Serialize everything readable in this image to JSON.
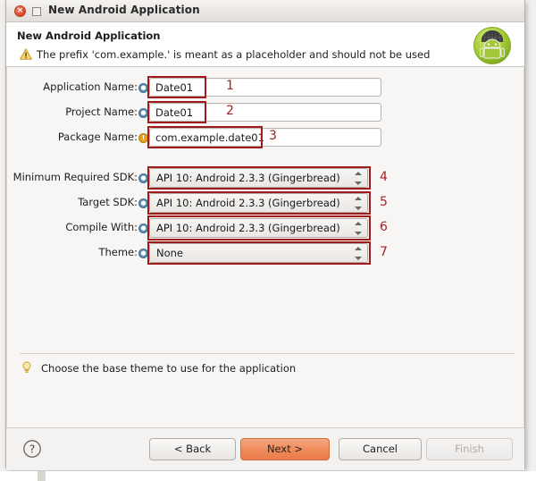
{
  "window": {
    "title": "New Android Application",
    "close_glyph": "×",
    "close_icon_name": "close-icon",
    "maximize_icon_name": "maximize-icon"
  },
  "header": {
    "title": "New Android Application",
    "message": "The prefix 'com.example.' is meant as a placeholder and should not be used",
    "warning_icon": "warning-triangle-icon",
    "logo_icon": "android-robot-icon"
  },
  "form": {
    "text_fields": [
      {
        "label": "Application Name:",
        "value": "Date01",
        "marker": "info",
        "marker_glyph": "●",
        "annotation": "1"
      },
      {
        "label": "Project Name:",
        "value": "Date01",
        "marker": "info",
        "marker_glyph": "●",
        "annotation": "2"
      },
      {
        "label": "Package Name:",
        "value": "com.example.date01",
        "marker": "warn",
        "marker_glyph": "!",
        "annotation": "3"
      }
    ],
    "combos": [
      {
        "label": "Minimum Required SDK:",
        "value": "API 10: Android 2.3.3 (Gingerbread)",
        "marker": "info",
        "marker_glyph": "●",
        "annotation": "4"
      },
      {
        "label": "Target SDK:",
        "value": "API 10: Android 2.3.3 (Gingerbread)",
        "marker": "info",
        "marker_glyph": "●",
        "annotation": "5"
      },
      {
        "label": "Compile With:",
        "value": "API 10: Android 2.3.3 (Gingerbread)",
        "marker": "info",
        "marker_glyph": "●",
        "annotation": "6"
      },
      {
        "label": "Theme:",
        "value": "None",
        "marker": "info",
        "marker_glyph": "●",
        "annotation": "7"
      }
    ]
  },
  "hint": {
    "icon": "lightbulb-icon",
    "text": "Choose the base theme to use for the application"
  },
  "footer": {
    "help_icon": "help-question-icon",
    "buttons": {
      "back": "< Back",
      "next": "Next >",
      "cancel": "Cancel",
      "finish": "Finish"
    }
  },
  "colors": {
    "annotation_red": "#9e1b1b",
    "annotation_number": "#a32222",
    "next_button_accent": "#ef8a5a",
    "android_green": "#9cc62c",
    "close_button": "#df4b29"
  }
}
